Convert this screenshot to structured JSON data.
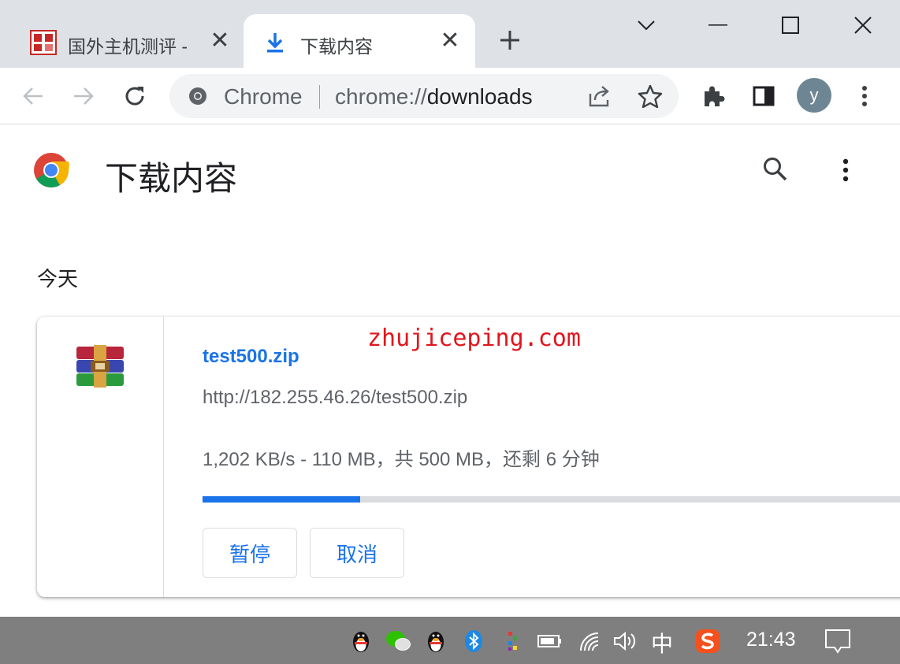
{
  "window": {
    "tabs": [
      {
        "title": "国外主机测评 - ",
        "active": false,
        "icon": "site-favicon"
      },
      {
        "title": "下载内容",
        "active": true,
        "icon": "download-icon"
      }
    ],
    "new_tab_icon": "plus-icon",
    "controls": [
      "tab-search-chevron-icon",
      "minimize-icon",
      "maximize-icon",
      "close-icon"
    ]
  },
  "toolbar": {
    "omnibox": {
      "site_label": "Chrome",
      "url_scheme": "chrome://",
      "url_path": "downloads"
    },
    "avatar_letter": "y"
  },
  "page": {
    "title": "下载内容",
    "section_label": "今天"
  },
  "download": {
    "file_name": "test500.zip",
    "url": "http://182.255.46.26/test500.zip",
    "status": "1,202 KB/s - 110 MB，共 500 MB，还剩 6 分钟",
    "progress": 0.22,
    "pause_label": "暂停",
    "cancel_label": "取消"
  },
  "watermark": "zhujiceping.com",
  "taskbar": {
    "ime": "中",
    "clock": "21:43"
  },
  "colors": {
    "accent": "#1a73e8",
    "tabstrip": "#dee1e6",
    "taskbar": "#7f7f7f",
    "watermark": "#e0161c"
  }
}
